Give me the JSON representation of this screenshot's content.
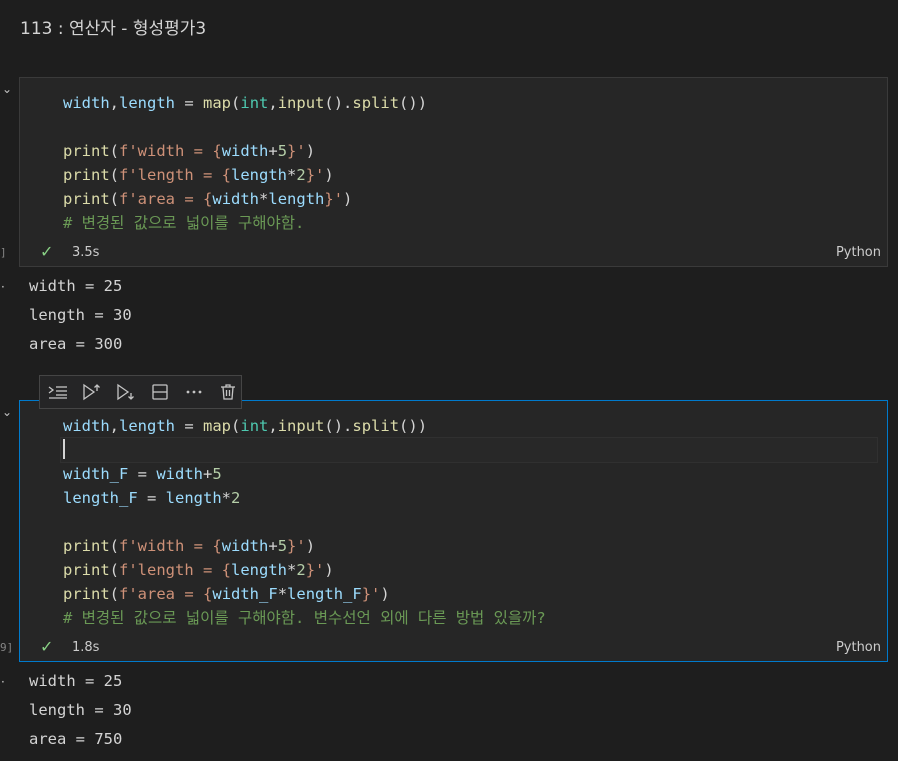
{
  "title": "113 : 연산자 - 형성평가3",
  "cell1": {
    "exec_label": "]",
    "lines": [
      [
        {
          "t": "width",
          "c": "v"
        },
        {
          "t": ",",
          "c": ""
        },
        {
          "t": "length",
          "c": "v"
        },
        {
          "t": " = ",
          "c": ""
        },
        {
          "t": "map",
          "c": "f"
        },
        {
          "t": "(",
          "c": ""
        },
        {
          "t": "int",
          "c": "t"
        },
        {
          "t": ",",
          "c": ""
        },
        {
          "t": "input",
          "c": "f"
        },
        {
          "t": "().",
          "c": ""
        },
        {
          "t": "split",
          "c": "f"
        },
        {
          "t": "())",
          "c": ""
        }
      ],
      [],
      [
        {
          "t": "print",
          "c": "f"
        },
        {
          "t": "(",
          "c": ""
        },
        {
          "t": "f'width = ",
          "c": "s"
        },
        {
          "t": "{",
          "c": "s"
        },
        {
          "t": "width",
          "c": "v"
        },
        {
          "t": "+",
          "c": ""
        },
        {
          "t": "5",
          "c": "n"
        },
        {
          "t": "}'",
          "c": "s"
        },
        {
          "t": ")",
          "c": ""
        }
      ],
      [
        {
          "t": "print",
          "c": "f"
        },
        {
          "t": "(",
          "c": ""
        },
        {
          "t": "f'length = ",
          "c": "s"
        },
        {
          "t": "{",
          "c": "s"
        },
        {
          "t": "length",
          "c": "v"
        },
        {
          "t": "*",
          "c": ""
        },
        {
          "t": "2",
          "c": "n"
        },
        {
          "t": "}'",
          "c": "s"
        },
        {
          "t": ")",
          "c": ""
        }
      ],
      [
        {
          "t": "print",
          "c": "f"
        },
        {
          "t": "(",
          "c": ""
        },
        {
          "t": "f'area = ",
          "c": "s"
        },
        {
          "t": "{",
          "c": "s"
        },
        {
          "t": "width",
          "c": "v"
        },
        {
          "t": "*",
          "c": ""
        },
        {
          "t": "length",
          "c": "v"
        },
        {
          "t": "}'",
          "c": "s"
        },
        {
          "t": ")",
          "c": ""
        }
      ],
      [
        {
          "t": "# 변경된 값으로 넓이를 구해야함.",
          "c": "c"
        }
      ]
    ],
    "duration": "3.5s",
    "language": "Python",
    "output": [
      "width = 25",
      "length = 30",
      "area = 300"
    ]
  },
  "cell2": {
    "exec_label": "9]",
    "lines": [
      [
        {
          "t": "width",
          "c": "v"
        },
        {
          "t": ",",
          "c": ""
        },
        {
          "t": "length",
          "c": "v"
        },
        {
          "t": " = ",
          "c": ""
        },
        {
          "t": "map",
          "c": "f"
        },
        {
          "t": "(",
          "c": ""
        },
        {
          "t": "int",
          "c": "t"
        },
        {
          "t": ",",
          "c": ""
        },
        {
          "t": "input",
          "c": "f"
        },
        {
          "t": "().",
          "c": ""
        },
        {
          "t": "split",
          "c": "f"
        },
        {
          "t": "())",
          "c": ""
        }
      ],
      [],
      [
        {
          "t": "width_F",
          "c": "v"
        },
        {
          "t": " = ",
          "c": ""
        },
        {
          "t": "width",
          "c": "v"
        },
        {
          "t": "+",
          "c": ""
        },
        {
          "t": "5",
          "c": "n"
        }
      ],
      [
        {
          "t": "length_F",
          "c": "v"
        },
        {
          "t": " = ",
          "c": ""
        },
        {
          "t": "length",
          "c": "v"
        },
        {
          "t": "*",
          "c": ""
        },
        {
          "t": "2",
          "c": "n"
        }
      ],
      [],
      [
        {
          "t": "print",
          "c": "f"
        },
        {
          "t": "(",
          "c": ""
        },
        {
          "t": "f'width = ",
          "c": "s"
        },
        {
          "t": "{",
          "c": "s"
        },
        {
          "t": "width",
          "c": "v"
        },
        {
          "t": "+",
          "c": ""
        },
        {
          "t": "5",
          "c": "n"
        },
        {
          "t": "}'",
          "c": "s"
        },
        {
          "t": ")",
          "c": ""
        }
      ],
      [
        {
          "t": "print",
          "c": "f"
        },
        {
          "t": "(",
          "c": ""
        },
        {
          "t": "f'length = ",
          "c": "s"
        },
        {
          "t": "{",
          "c": "s"
        },
        {
          "t": "length",
          "c": "v"
        },
        {
          "t": "*",
          "c": ""
        },
        {
          "t": "2",
          "c": "n"
        },
        {
          "t": "}'",
          "c": "s"
        },
        {
          "t": ")",
          "c": ""
        }
      ],
      [
        {
          "t": "print",
          "c": "f"
        },
        {
          "t": "(",
          "c": ""
        },
        {
          "t": "f'area = ",
          "c": "s"
        },
        {
          "t": "{",
          "c": "s"
        },
        {
          "t": "width_F",
          "c": "v"
        },
        {
          "t": "*",
          "c": ""
        },
        {
          "t": "length_F",
          "c": "v"
        },
        {
          "t": "}'",
          "c": "s"
        },
        {
          "t": ")",
          "c": ""
        }
      ],
      [
        {
          "t": "# 변경된 값으로 넓이를 구해야함. 변수선언 외에 다른 방법 있을까?",
          "c": "c"
        }
      ]
    ],
    "cursor_line": 1,
    "duration": "1.8s",
    "language": "Python",
    "output": [
      "width = 25",
      "length = 30",
      "area = 750"
    ]
  },
  "toolbar": {
    "icons": [
      "run-by-line-icon",
      "execute-above-icon",
      "execute-below-icon",
      "split-cell-icon",
      "more-actions-icon",
      "delete-cell-icon"
    ]
  },
  "colors": {
    "background": "#1e1e1e",
    "cell_background": "#262626",
    "active_border": "#007acc",
    "success_check": "#89d185"
  }
}
